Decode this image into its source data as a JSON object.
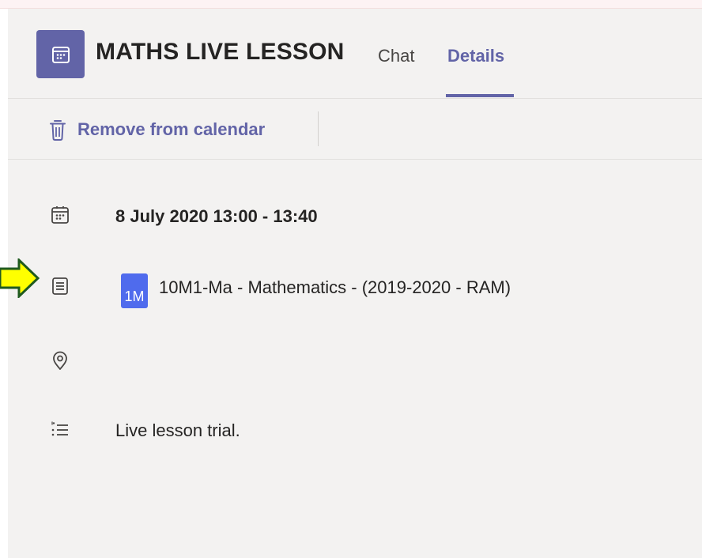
{
  "meeting": {
    "title": "MATHS LIVE LESSON",
    "app_icon": "calendar-icon"
  },
  "tabs": [
    {
      "label": "Chat",
      "active": false
    },
    {
      "label": "Details",
      "active": true
    }
  ],
  "toolbar": {
    "remove_label": "Remove from calendar",
    "remove_icon": "trash-icon"
  },
  "details": {
    "date_time": "8 July 2020 13:00 - 13:40",
    "channel": {
      "badge": "1M",
      "badge_color": "#4f6bed",
      "name": "10M1-Ma - Mathematics - (2019-2020 - RAM)"
    },
    "location": "",
    "description": "Live lesson trial."
  },
  "colors": {
    "accent": "#6264a7",
    "panel_bg": "#f3f2f1",
    "pointer_arrow_fill": "#ffff00",
    "pointer_arrow_stroke": "#1f5a1f"
  }
}
